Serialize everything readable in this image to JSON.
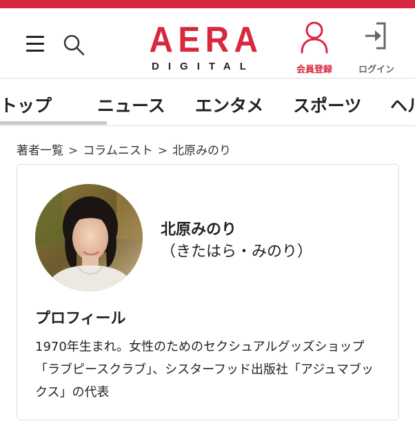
{
  "header": {
    "logo": {
      "main": "AERA",
      "sub": "DIGITAL"
    },
    "register_label": "会員登録",
    "login_label": "ログイン",
    "accent_color": "#d8283f"
  },
  "icons": {
    "menu": "hamburger-menu-icon",
    "search": "search-icon",
    "register": "user-icon",
    "login": "login-arrow-icon"
  },
  "nav": {
    "tabs": [
      {
        "label": "トップ",
        "active": true
      },
      {
        "label": "ニュース"
      },
      {
        "label": "エンタメ"
      },
      {
        "label": "スポーツ"
      },
      {
        "label": "ヘル"
      }
    ]
  },
  "breadcrumb": {
    "items": [
      "著者一覧",
      "コラムニスト",
      "北原みのり"
    ],
    "separator": ">"
  },
  "author": {
    "name": "北原みのり",
    "kana": "（きたはら・みのり）",
    "profile_heading": "プロフィール",
    "profile_text": "1970年生まれ。女性のためのセクシュアルグッズショップ「ラブピースクラブ」、シスターフッド出版社「アジュマブックス」の代表"
  }
}
